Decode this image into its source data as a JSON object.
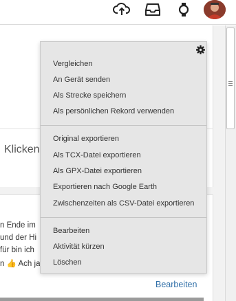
{
  "header": {
    "icons": [
      "upload-cloud-icon",
      "inbox-icon",
      "watch-icon"
    ],
    "avatar": "user-avatar"
  },
  "background": {
    "klicken_text": "Klicken",
    "snippet_lines": [
      "n Ende im",
      "und der Hi",
      "für bin ich",
      "n",
      "Ach ja"
    ],
    "thumb_glyph": "👍",
    "edit_link": "Bearbeiten"
  },
  "menu": {
    "settings_icon": "gear-icon",
    "group1": [
      "Vergleichen",
      "An Gerät senden",
      "Als Strecke speichern",
      "Als persönlichen Rekord verwenden"
    ],
    "group2": [
      "Original exportieren",
      "Als TCX-Datei exportieren",
      "Als GPX-Datei exportieren",
      "Exportieren nach Google Earth",
      "Zwischenzeiten als CSV-Datei exportieren"
    ],
    "group3": [
      "Bearbeiten",
      "Aktivität kürzen",
      "Löschen"
    ]
  },
  "colors": {
    "link": "#2f6fa8",
    "menu_bg": "#e6e6e6"
  }
}
